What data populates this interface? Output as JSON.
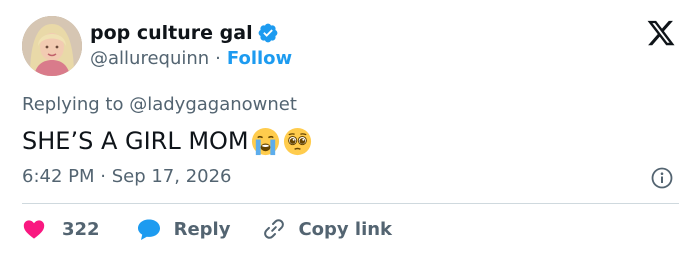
{
  "author": {
    "display_name": "pop culture gal",
    "handle": "@allurequinn",
    "separator": "·",
    "follow_label": "Follow",
    "verified": true
  },
  "platform_icon": "x-logo-icon",
  "reply_context": {
    "prefix": "Replying to ",
    "handle": "@ladygaganownet"
  },
  "tweet": {
    "text": "SHE’S A GIRL MOM",
    "emojis": [
      "loudly-crying-face-emoji",
      "pleading-face-emoji"
    ]
  },
  "timestamp": {
    "time": "6:42 PM",
    "separator": " · ",
    "date": "Sep 17, 2026"
  },
  "actions": {
    "like_count": "322",
    "reply_label": "Reply",
    "copy_link_label": "Copy link"
  },
  "colors": {
    "accent": "#1d9bf0",
    "like": "#f91880",
    "secondary_text": "#536471",
    "primary_text": "#0f1419",
    "divider": "#cfd9de"
  }
}
